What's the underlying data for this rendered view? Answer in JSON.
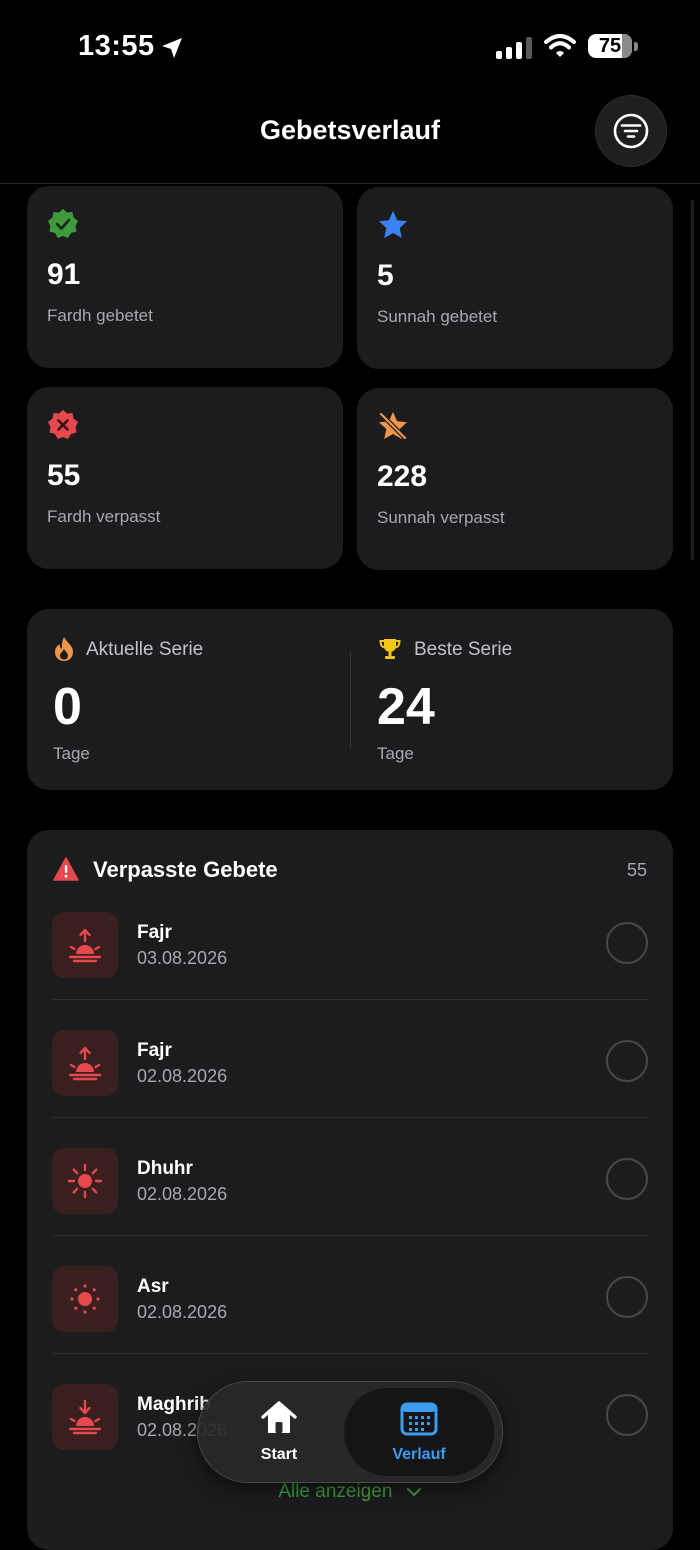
{
  "status_bar": {
    "time": "13:55",
    "battery": "75"
  },
  "header": {
    "title": "Gebetsverlauf"
  },
  "stats": [
    {
      "value": "91",
      "label": "Fardh gebetet",
      "icon": "check-badge-icon",
      "color": "#3e9a3a"
    },
    {
      "value": "5",
      "label": "Sunnah gebetet",
      "icon": "star-icon",
      "color": "#3b82f6"
    },
    {
      "value": "55",
      "label": "Fardh verpasst",
      "icon": "x-badge-icon",
      "color": "#e5484d"
    },
    {
      "value": "228",
      "label": "Sunnah verpasst",
      "icon": "star-slash-icon",
      "color": "#f0954a"
    }
  ],
  "streak": {
    "current": {
      "title": "Aktuelle Serie",
      "value": "0",
      "unit": "Tage"
    },
    "best": {
      "title": "Beste Serie",
      "value": "24",
      "unit": "Tage"
    }
  },
  "missed": {
    "title": "Verpasste Gebete",
    "count": "55",
    "items": [
      {
        "name": "Fajr",
        "date": "03.08.2026",
        "icon": "sunrise-icon"
      },
      {
        "name": "Fajr",
        "date": "02.08.2026",
        "icon": "sunrise-icon"
      },
      {
        "name": "Dhuhr",
        "date": "02.08.2026",
        "icon": "sun-icon"
      },
      {
        "name": "Asr",
        "date": "02.08.2026",
        "icon": "sun-small-icon"
      },
      {
        "name": "Maghrib",
        "date": "02.08.2026",
        "icon": "sunset-icon"
      }
    ],
    "show_all": "Alle anzeigen"
  },
  "tabs": [
    {
      "label": "Start",
      "icon": "home-icon"
    },
    {
      "label": "Verlauf",
      "icon": "calendar-icon",
      "active_color": "#3b9cf0"
    }
  ],
  "colors": {
    "accent_red": "#e5484d",
    "accent_green": "#3fa140",
    "card": "#1c1c1e"
  }
}
